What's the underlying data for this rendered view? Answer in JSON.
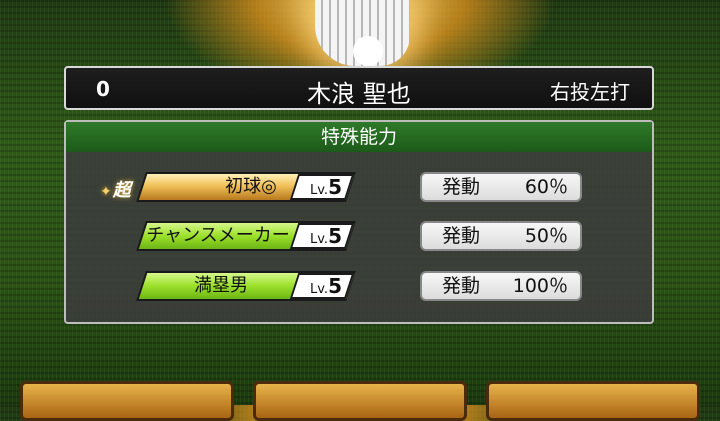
{
  "header": {
    "number": "0",
    "name": "木浪 聖也",
    "handedness": "右投左打"
  },
  "panel": {
    "title": "特殊能力",
    "skills": [
      {
        "badge": "超",
        "name": "初球◎",
        "lv_label": "Lv.",
        "level": "5",
        "rate_label": "発動",
        "rate": "60％",
        "style": "gold"
      },
      {
        "name": "チャンスメーカー",
        "lv_label": "Lv.",
        "level": "5",
        "rate_label": "発動",
        "rate": "50％",
        "style": "green"
      },
      {
        "name": "満塁男",
        "lv_label": "Lv.",
        "level": "5",
        "rate_label": "発動",
        "rate": "100％",
        "style": "green"
      }
    ]
  }
}
